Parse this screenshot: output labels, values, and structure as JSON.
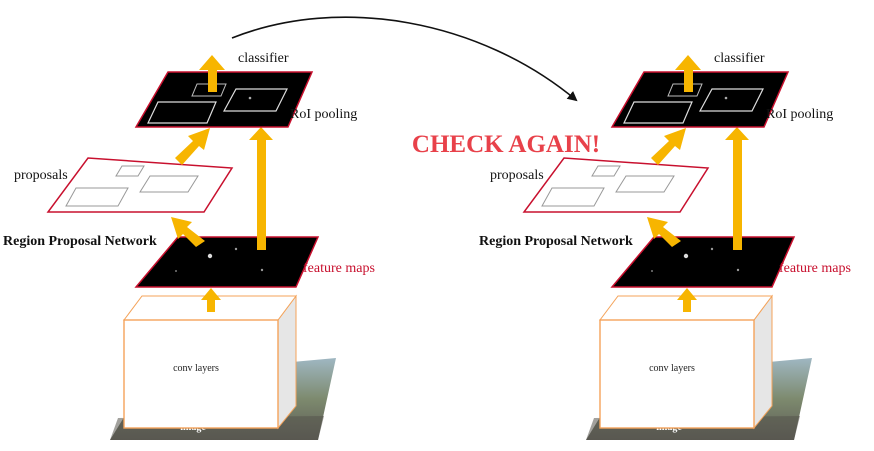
{
  "banner": {
    "text": "CHECK AGAIN!",
    "color": "#e8414a"
  },
  "colors": {
    "arrow": "#f7b500",
    "red": "#c8102e",
    "conv_border": "#f4a35a",
    "map": "#000000"
  },
  "diagrams": [
    {
      "labels": {
        "classifier": "classifier",
        "roi_pooling": "RoI pooling",
        "proposals": "proposals",
        "rpn": "Region Proposal Network",
        "feature_maps": "feature maps",
        "conv_layers": "conv layers",
        "image": "image"
      }
    },
    {
      "labels": {
        "classifier": "classifier",
        "roi_pooling": "RoI pooling",
        "proposals": "proposals",
        "rpn": "Region Proposal Network",
        "feature_maps": "feature maps",
        "conv_layers": "conv layers",
        "image": "image"
      }
    }
  ]
}
